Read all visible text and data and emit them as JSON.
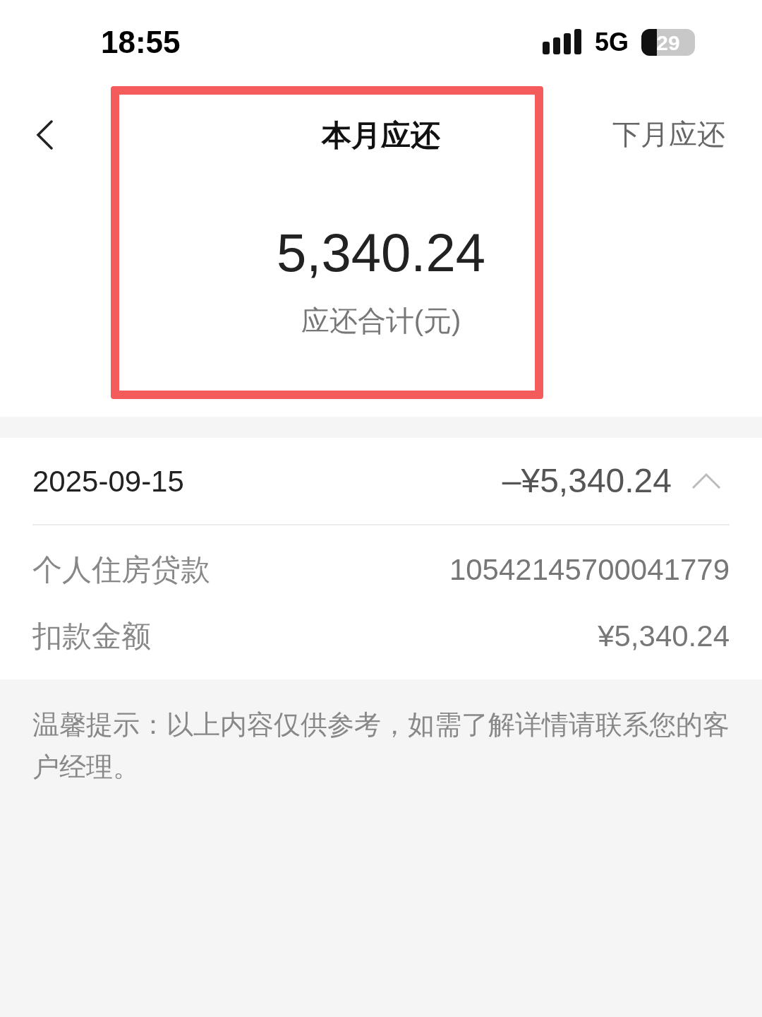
{
  "status_bar": {
    "time": "18:55",
    "network": "5G",
    "battery": "29"
  },
  "header": {
    "tabs": [
      {
        "label": "本月应还",
        "selected": true
      },
      {
        "label": "下月应还",
        "selected": false
      }
    ]
  },
  "summary": {
    "amount": "5,340.24",
    "caption": "应还合计(元)",
    "highlighted": true
  },
  "record": {
    "date": "2025-09-15",
    "amount": "–¥5,340.24",
    "expanded": true,
    "details": [
      {
        "label": "个人住房贷款",
        "value": "10542145700041779"
      },
      {
        "label": "扣款金额",
        "value": "¥5,340.24"
      }
    ]
  },
  "notice": "温馨提示：以上内容仅供参考，如需了解详情请联系您的客户经理。"
}
